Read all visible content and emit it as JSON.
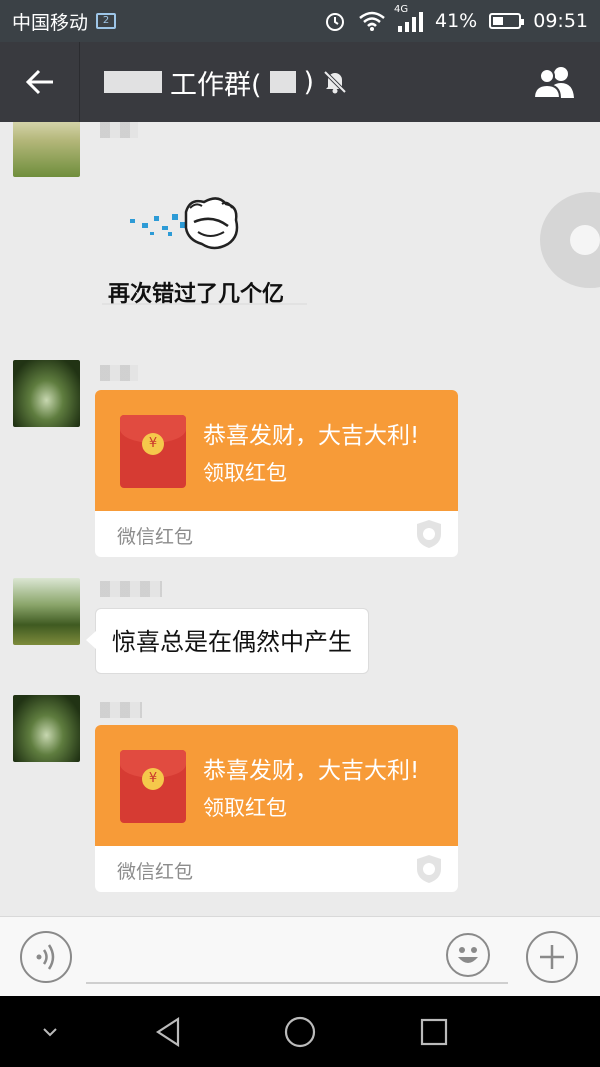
{
  "status": {
    "carrier": "中国移动",
    "sim_label": "2",
    "network": "4G",
    "battery_percent": "41%",
    "battery_level": 0.41,
    "time": "09:51"
  },
  "header": {
    "title_visible": "工作群(",
    "title_close": ")",
    "back_icon": "arrow-left-icon",
    "mute_icon": "bell-off-icon",
    "members_icon": "group-icon"
  },
  "messages": [
    {
      "type": "sticker",
      "text": "再次错过了几个亿"
    },
    {
      "type": "red_packet",
      "title": "恭喜发财，大吉大利!",
      "action": "领取红包",
      "footer": "微信红包",
      "coin": "¥"
    },
    {
      "type": "text",
      "text": "惊喜总是在偶然中产生"
    },
    {
      "type": "red_packet",
      "title": "恭喜发财，大吉大利!",
      "action": "领取红包",
      "footer": "微信红包",
      "coin": "¥"
    }
  ],
  "input": {
    "voice_icon": "voice-icon",
    "emoji_icon": "emoji-icon",
    "plus_icon": "plus-icon"
  },
  "nav": {
    "down_icon": "chevron-down-icon",
    "back_icon": "triangle-back-icon",
    "home_icon": "circle-home-icon",
    "recents_icon": "square-recents-icon"
  },
  "colors": {
    "titlebar": "#393a3f",
    "statusbar": "#3b4146",
    "red_packet": "#f79b38",
    "envelope": "#d63b33",
    "chat_bg": "#ebebeb"
  }
}
